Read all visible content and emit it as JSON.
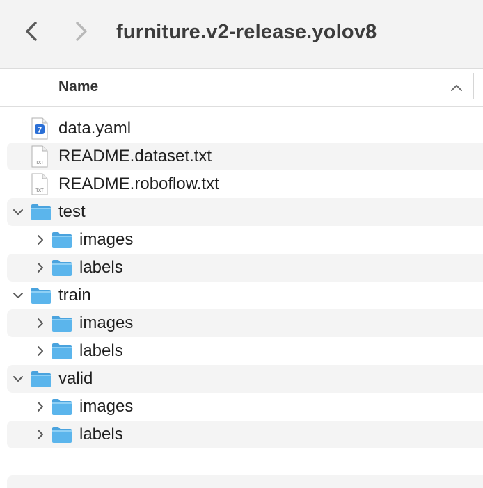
{
  "window": {
    "title": "furniture.v2-release.yolov8"
  },
  "header": {
    "column_name": "Name",
    "sort_direction": "ascending"
  },
  "files": [
    {
      "name": "data.yaml",
      "kind": "yaml-file-icon"
    },
    {
      "name": "README.dataset.txt",
      "kind": "txt-file-icon",
      "badge": "TXT"
    },
    {
      "name": "README.roboflow.txt",
      "kind": "txt-file-icon",
      "badge": "TXT"
    }
  ],
  "folders": [
    {
      "name": "test",
      "expanded": true,
      "children": [
        {
          "name": "images"
        },
        {
          "name": "labels"
        }
      ]
    },
    {
      "name": "train",
      "expanded": true,
      "children": [
        {
          "name": "images"
        },
        {
          "name": "labels"
        }
      ]
    },
    {
      "name": "valid",
      "expanded": true,
      "children": [
        {
          "name": "images"
        },
        {
          "name": "labels"
        }
      ]
    }
  ],
  "colors": {
    "folder": "#5bb5ec",
    "yaml_accent": "#2b6fd6",
    "row_stripe": "#f4f4f4"
  }
}
